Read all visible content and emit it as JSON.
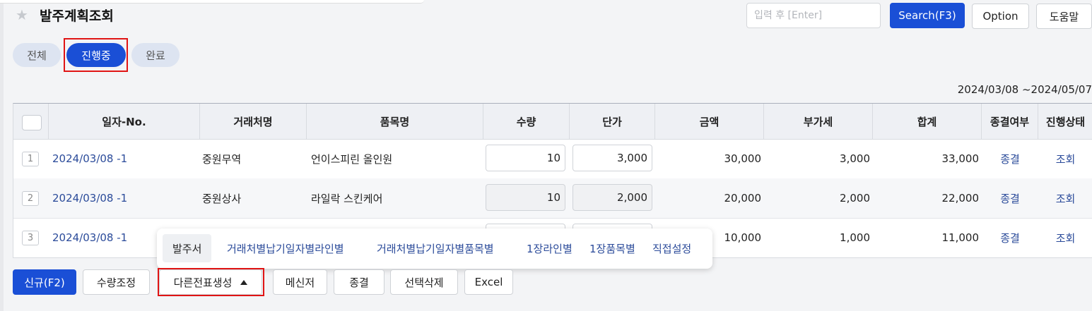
{
  "header": {
    "title": "발주계획조회",
    "search_placeholder": "입력 후 [Enter]",
    "search_label": "Search(F3)",
    "option_label": "Option",
    "help_label": "도움말"
  },
  "tabs": [
    {
      "label": "전체"
    },
    {
      "label": "진행중"
    },
    {
      "label": "완료"
    }
  ],
  "active_tab": "진행중",
  "date_range": "2024/03/08 ~2024/05/07",
  "table": {
    "columns": [
      "일자-No.",
      "거래처명",
      "품목명",
      "수량",
      "단가",
      "금액",
      "부가세",
      "합계",
      "종결여부",
      "진행상태"
    ],
    "rows": [
      {
        "num": "1",
        "date_no": "2024/03/08 -1",
        "vendor": "중원무역",
        "item": "언이스피린 올인원",
        "qty": "10",
        "price": "3,000",
        "amount": "30,000",
        "vat": "3,000",
        "total": "33,000",
        "close": "종결",
        "status": "조회"
      },
      {
        "num": "2",
        "date_no": "2024/03/08 -1",
        "vendor": "중원상사",
        "item": "라일락 스킨케어",
        "qty": "10",
        "price": "2,000",
        "amount": "20,000",
        "vat": "2,000",
        "total": "22,000",
        "close": "종결",
        "status": "조회"
      },
      {
        "num": "3",
        "date_no": "2024/03/08 -1",
        "vendor": "",
        "item": "",
        "qty": "",
        "price": "",
        "amount": "10,000",
        "vat": "1,000",
        "total": "11,000",
        "close": "종결",
        "status": "조회"
      }
    ]
  },
  "popup": {
    "items": [
      "발주서",
      "거래처별납기일자별라인별",
      "거래처별납기일자별품목별",
      "1장라인별",
      "1장품목별",
      "직접설정"
    ]
  },
  "toolbar": {
    "new_label": "신규(F2)",
    "qty_adjust_label": "수량조정",
    "other_slip_label": "다른전표생성",
    "messenger_label": "메신저",
    "close_label": "종결",
    "delete_label": "선택삭제",
    "excel_label": "Excel"
  },
  "colors": {
    "primary": "#1a4fd6",
    "link": "#2b4b9a",
    "highlight": "#e01414"
  }
}
